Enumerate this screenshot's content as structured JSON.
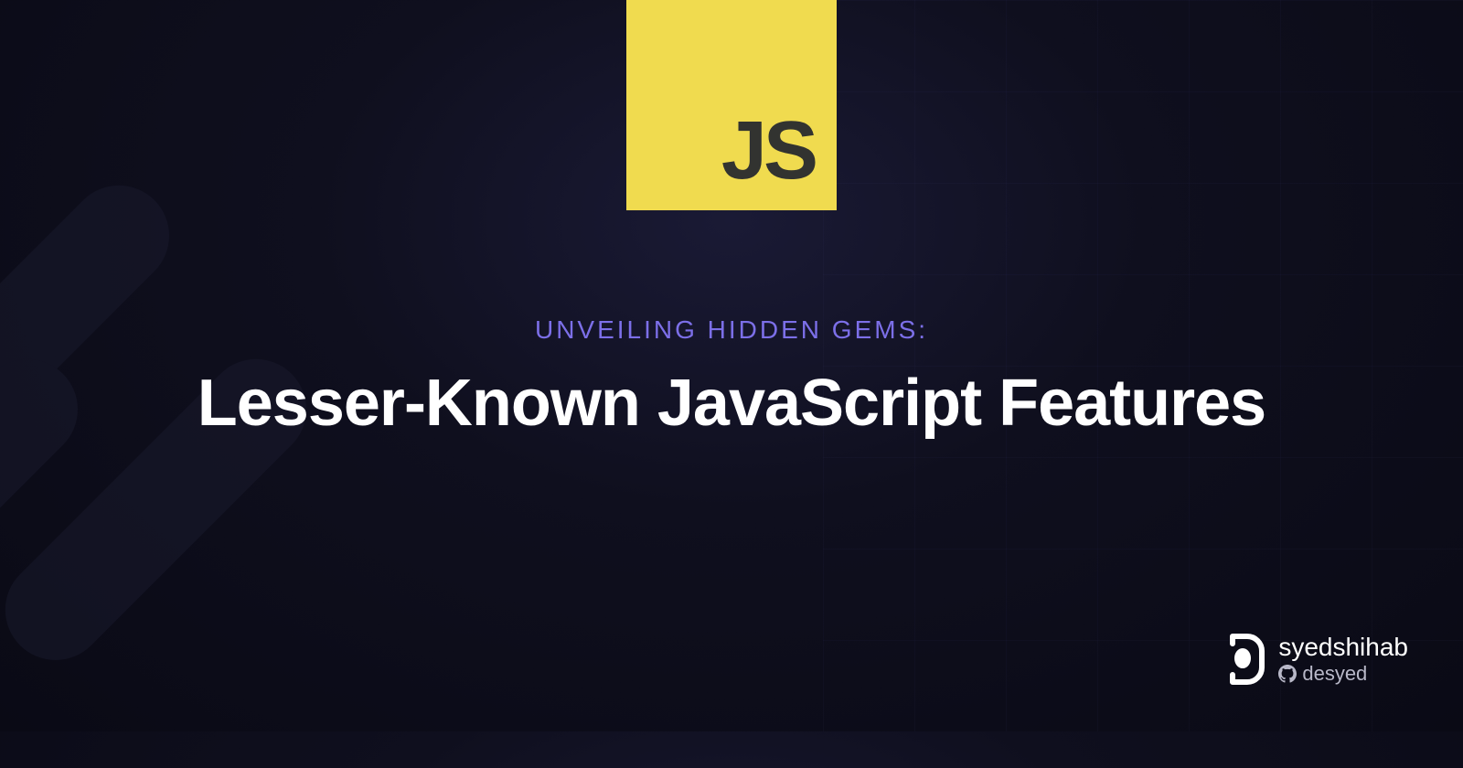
{
  "badge": {
    "label": "JS",
    "bg_color": "#F0DB4F",
    "text_color": "#323330"
  },
  "subtitle": "UNVEILING HIDDEN GEMS:",
  "title": "Lesser-Known JavaScript Features",
  "author": {
    "name_first": "syed",
    "name_last": "shihab",
    "handle_prefix": "de",
    "handle_suffix": "syed"
  },
  "colors": {
    "accent": "#7C6FE8",
    "text": "#FFFFFF"
  }
}
